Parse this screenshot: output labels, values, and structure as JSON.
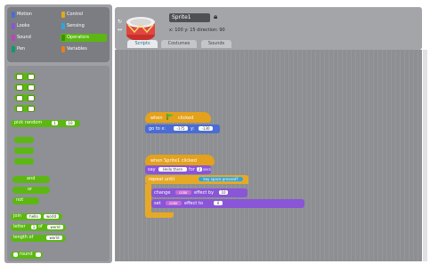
{
  "categories": [
    {
      "label": "Motion",
      "color": "#4a6cd4"
    },
    {
      "label": "Control",
      "color": "#e1a91a"
    },
    {
      "label": "Looks",
      "color": "#8a55d7"
    },
    {
      "label": "Sensing",
      "color": "#2ca5e2"
    },
    {
      "label": "Sound",
      "color": "#bb42c3"
    },
    {
      "label": "Operators",
      "color": "#5cb712"
    },
    {
      "label": "Pen",
      "color": "#0e9a6c"
    },
    {
      "label": "Variables",
      "color": "#ee7d16"
    }
  ],
  "palette": {
    "pick_random": "pick random",
    "pick_from": "1",
    "pick_to": "10",
    "and": "and",
    "or": "or",
    "not": "not",
    "join": "join",
    "join_a": "hello",
    "join_b": "world",
    "letter": "letter",
    "letter_n": "1",
    "letter_of": "of",
    "letter_word": "world",
    "length_of": "length of",
    "length_word": "world",
    "round": "round"
  },
  "sprite": {
    "name": "Sprite1",
    "coords": "x: 100  y: 15  direction: 90"
  },
  "tabs": [
    {
      "label": "Scripts"
    },
    {
      "label": "Costumes"
    },
    {
      "label": "Sounds"
    }
  ],
  "scripts": {
    "s1_when": "when",
    "s1_clicked": "clicked",
    "s1_goto": "go to x:",
    "s1_x": "-175",
    "s1_y_label": "y:",
    "s1_y": "-130",
    "s2_when": "when Sprite1 clicked",
    "s2_say": "say",
    "s2_say_text": "Hello there",
    "s2_for": "for",
    "s2_for_n": "2",
    "s2_secs": "secs",
    "s2_repeat": "repeat until",
    "s2_cond": "key space pressed?",
    "s2_change": "change",
    "s2_change_what": "color",
    "s2_effect_by": "effect by",
    "s2_change_n": "10",
    "s2_set": "set",
    "s2_set_what": "color",
    "s2_set_to": "effect to",
    "s2_set_n": "0"
  }
}
